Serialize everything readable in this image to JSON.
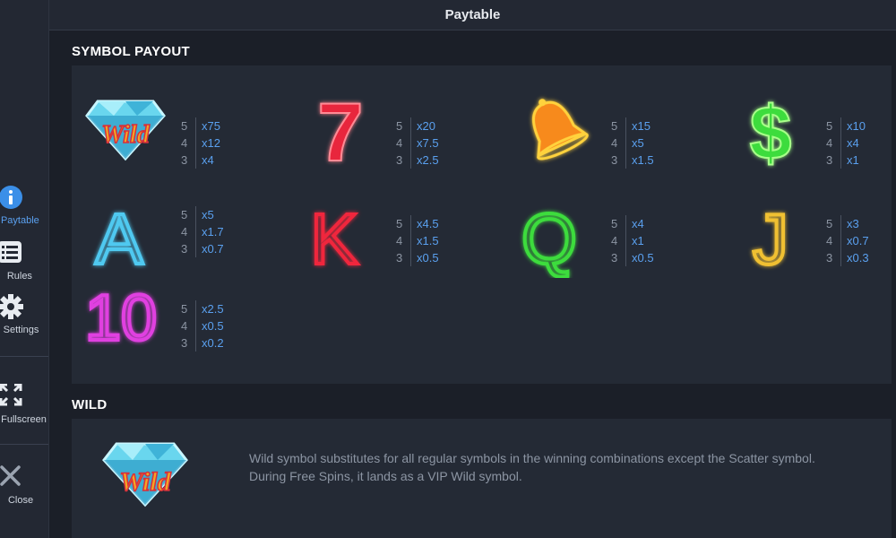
{
  "header": {
    "title": "Paytable"
  },
  "sidebar": {
    "items": [
      {
        "label": "Paytable",
        "icon": "info-icon"
      },
      {
        "label": "Rules",
        "icon": "list-icon"
      },
      {
        "label": "Settings",
        "icon": "gear-icon"
      },
      {
        "label": "Fullscreen",
        "icon": "fullscreen-icon"
      },
      {
        "label": "Close",
        "icon": "close-icon"
      }
    ]
  },
  "symbol_payout": {
    "title": "SYMBOL PAYOUT",
    "symbols": [
      {
        "name": "Wild",
        "icon": "diamond-wild-icon",
        "color": "#4fd2e8",
        "payouts": [
          {
            "count": "5",
            "mult": "x75"
          },
          {
            "count": "4",
            "mult": "x12"
          },
          {
            "count": "3",
            "mult": "x4"
          }
        ]
      },
      {
        "name": "7",
        "icon": "seven-icon",
        "color": "#e8283c",
        "payouts": [
          {
            "count": "5",
            "mult": "x20"
          },
          {
            "count": "4",
            "mult": "x7.5"
          },
          {
            "count": "3",
            "mult": "x2.5"
          }
        ]
      },
      {
        "name": "Bell",
        "icon": "bell-icon",
        "color": "#f5a623",
        "payouts": [
          {
            "count": "5",
            "mult": "x15"
          },
          {
            "count": "4",
            "mult": "x5"
          },
          {
            "count": "3",
            "mult": "x1.5"
          }
        ]
      },
      {
        "name": "$",
        "icon": "dollar-icon",
        "color": "#3ddc3d",
        "payouts": [
          {
            "count": "5",
            "mult": "x10"
          },
          {
            "count": "4",
            "mult": "x4"
          },
          {
            "count": "3",
            "mult": "x1"
          }
        ]
      },
      {
        "name": "A",
        "icon": "letter-a-icon",
        "color": "#4fc9f0",
        "payouts": [
          {
            "count": "5",
            "mult": "x5"
          },
          {
            "count": "4",
            "mult": "x1.7"
          },
          {
            "count": "3",
            "mult": "x0.7"
          }
        ]
      },
      {
        "name": "K",
        "icon": "letter-k-icon",
        "color": "#f0283c",
        "payouts": [
          {
            "count": "5",
            "mult": "x4.5"
          },
          {
            "count": "4",
            "mult": "x1.5"
          },
          {
            "count": "3",
            "mult": "x0.5"
          }
        ]
      },
      {
        "name": "Q",
        "icon": "letter-q-icon",
        "color": "#3ddc3d",
        "payouts": [
          {
            "count": "5",
            "mult": "x4"
          },
          {
            "count": "4",
            "mult": "x1"
          },
          {
            "count": "3",
            "mult": "x0.5"
          }
        ]
      },
      {
        "name": "J",
        "icon": "letter-j-icon",
        "color": "#f0c030",
        "payouts": [
          {
            "count": "5",
            "mult": "x3"
          },
          {
            "count": "4",
            "mult": "x0.7"
          },
          {
            "count": "3",
            "mult": "x0.3"
          }
        ]
      },
      {
        "name": "10",
        "icon": "number-ten-icon",
        "color": "#e040e0",
        "payouts": [
          {
            "count": "5",
            "mult": "x2.5"
          },
          {
            "count": "4",
            "mult": "x0.5"
          },
          {
            "count": "3",
            "mult": "x0.2"
          }
        ]
      }
    ]
  },
  "wild_section": {
    "title": "WILD",
    "icon": "diamond-wild-icon",
    "description_line1": "Wild symbol substitutes for all regular symbols in the winning combinations except the Scatter symbol.",
    "description_line2": "During Free Spins, it lands as a VIP Wild symbol."
  },
  "colors": {
    "background": "#1b1f28",
    "panel": "#242a35",
    "multiplier": "#5aa0ef",
    "count": "#8c95a3"
  }
}
